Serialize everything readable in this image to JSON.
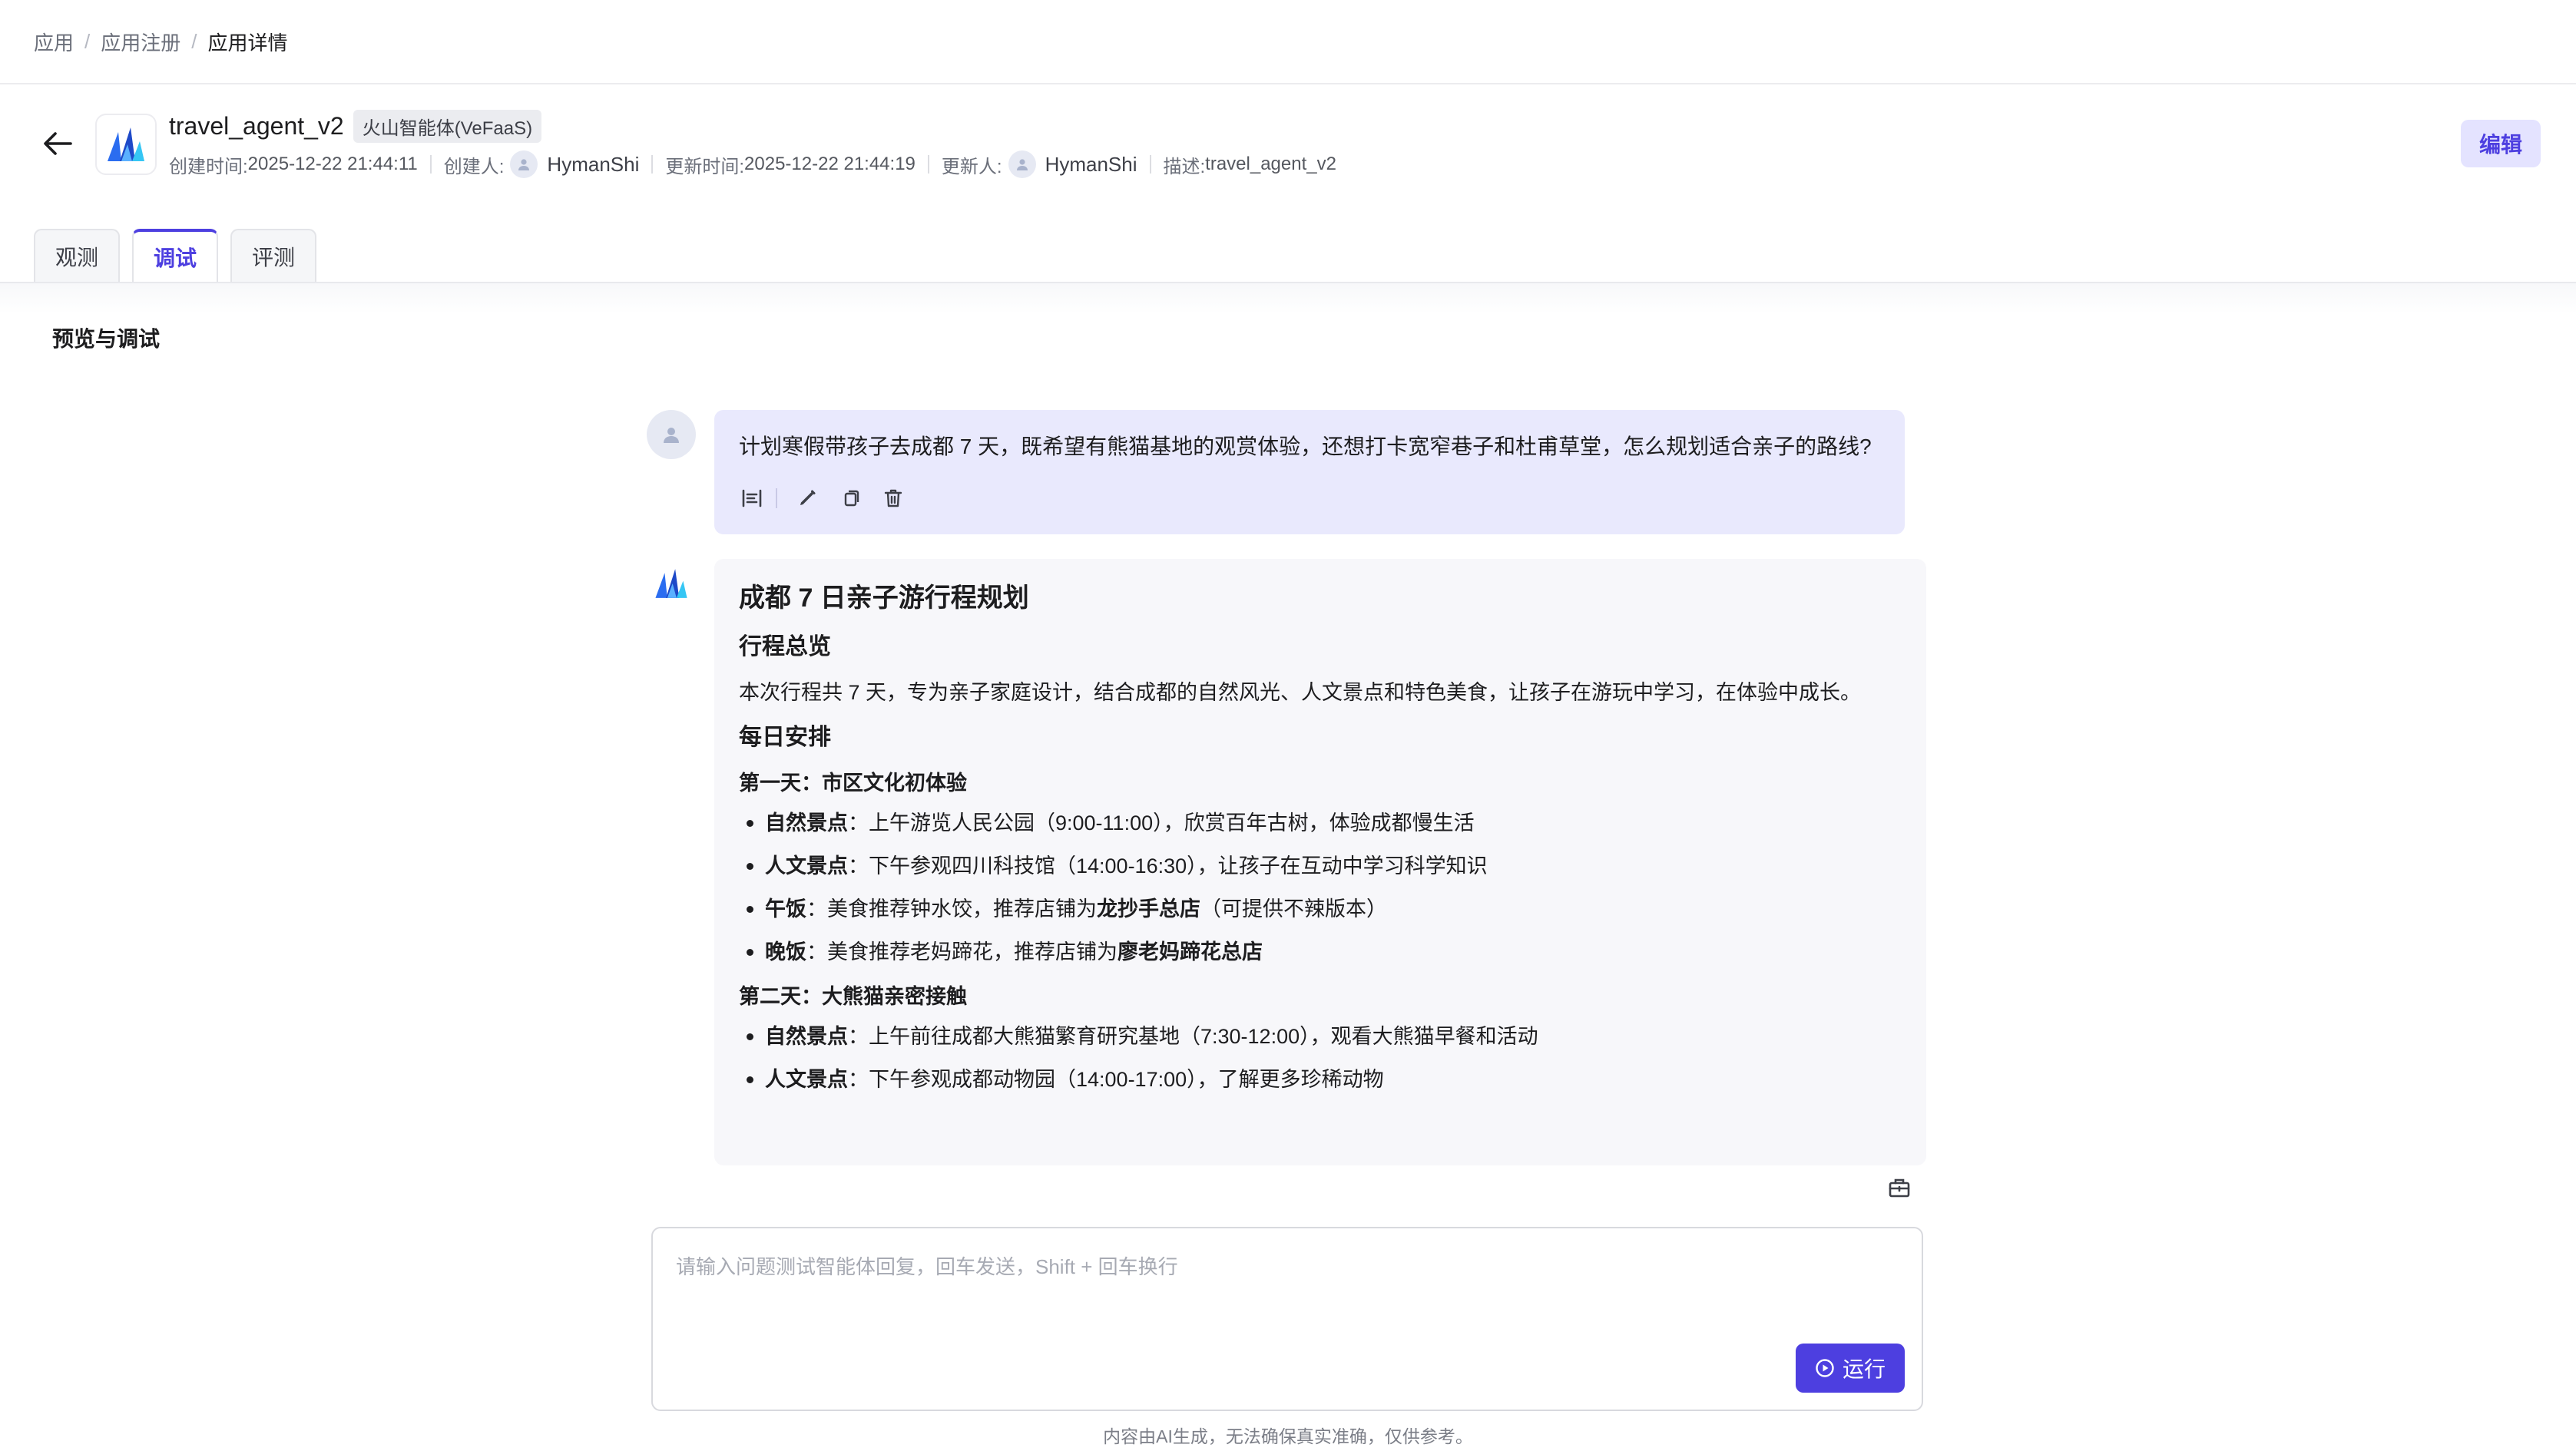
{
  "breadcrumb": {
    "items": [
      "应用",
      "应用注册"
    ],
    "current": "应用详情"
  },
  "app": {
    "name": "travel_agent_v2",
    "tag": "火山智能体(VeFaaS)",
    "created_label": "创建时间:",
    "created_value": "2025-12-22 21:44:11",
    "creator_label": "创建人:",
    "creator": "HymanShi",
    "updated_label": "更新时间:",
    "updated_value": "2025-12-22 21:44:19",
    "updater_label": "更新人:",
    "updater": "HymanShi",
    "desc_label": "描述:",
    "desc_value": "travel_agent_v2"
  },
  "actions": {
    "edit_label": "编辑"
  },
  "tabs": [
    {
      "label": "观测",
      "active": false
    },
    {
      "label": "调试",
      "active": true
    },
    {
      "label": "评测",
      "active": false
    }
  ],
  "section_title": "预览与调试",
  "icons": {
    "back": "arrow-left-icon",
    "logo": "volcano-logo-icon",
    "avatar": "user-avatar-icon",
    "align": "align-icon",
    "edit": "pencil-icon",
    "copy": "copy-icon",
    "delete": "trash-icon",
    "toolbox": "toolbox-icon",
    "run": "play-circle-icon"
  },
  "colors": {
    "accent": "#4d3fe0",
    "user_bubble": "#e9e9fd",
    "bot_bubble": "#f7f7fa",
    "edit_bg": "#e4e3ff"
  },
  "conversation": {
    "user_message": "计划寒假带孩子去成都 7 天，既希望有熊猫基地的观赏体验，还想打卡宽窄巷子和杜甫草堂，怎么规划适合亲子的路线?",
    "answer": {
      "title": "成都 7 日亲子游行程规划",
      "overview_heading": "行程总览",
      "overview_text": "本次行程共 7 天，专为亲子家庭设计，结合成都的自然风光、人文景点和特色美食，让孩子在游玩中学习，在体验中成长。",
      "daily_heading": "每日安排",
      "day1": {
        "title": "第一天：市区文化初体验",
        "items": [
          {
            "label": "自然景点",
            "text": "：上午游览人民公园（9:00-11:00），欣赏百年古树，体验成都慢生活"
          },
          {
            "label": "人文景点",
            "text": "：下午参观四川科技馆（14:00-16:30），让孩子在互动中学习科学知识"
          },
          {
            "label": "午饭",
            "text": "：美食推荐钟水饺，推荐店铺为",
            "strong": "龙抄手总店",
            "tail": "（可提供不辣版本）"
          },
          {
            "label": "晚饭",
            "text": "：美食推荐老妈蹄花，推荐店铺为",
            "strong": "廖老妈蹄花总店"
          }
        ]
      },
      "day2": {
        "title": "第二天：大熊猫亲密接触",
        "items": [
          {
            "label": "自然景点",
            "text": "：上午前往成都大熊猫繁育研究基地（7:30-12:00），观看大熊猫早餐和活动"
          },
          {
            "label": "人文景点",
            "text": "：下午参观成都动物园（14:00-17:00），了解更多珍稀动物"
          }
        ]
      }
    }
  },
  "composer": {
    "placeholder": "请输入问题测试智能体回复，回车发送，Shift + 回车换行",
    "value": "",
    "run_label": "运行"
  },
  "disclaimer": "内容由AI生成，无法确保真实准确，仅供参考。"
}
